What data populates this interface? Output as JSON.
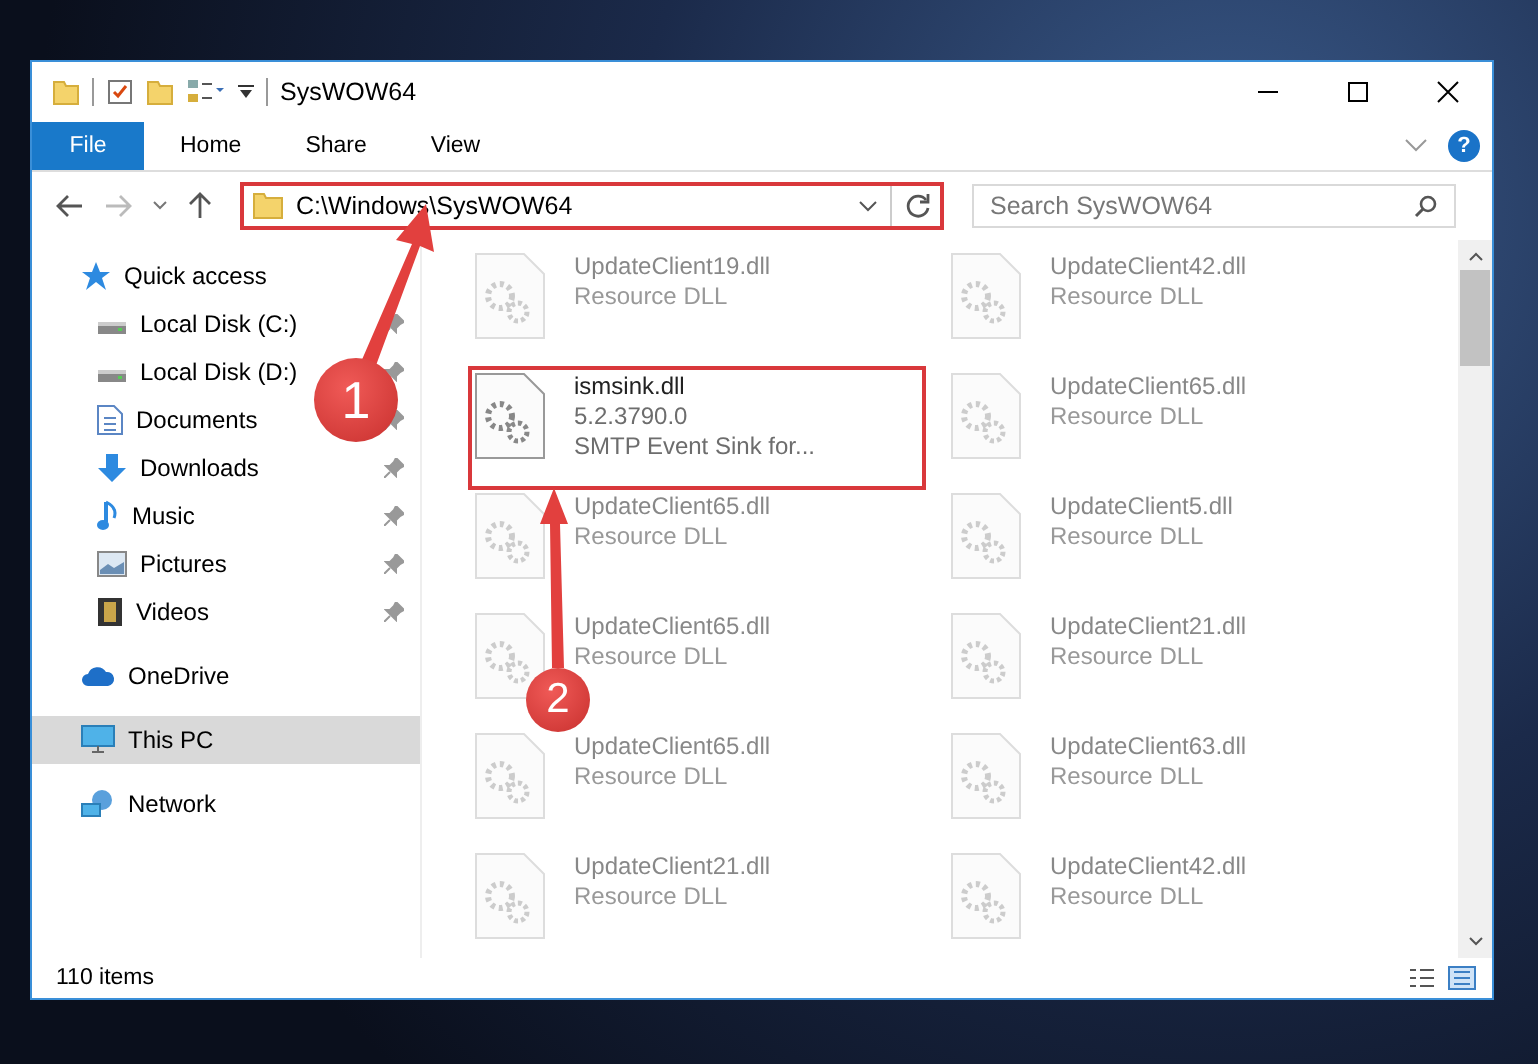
{
  "window": {
    "title": "SysWOW64"
  },
  "ribbon": {
    "tabs": [
      {
        "label": "File",
        "kind": "file"
      },
      {
        "label": "Home",
        "kind": "tab"
      },
      {
        "label": "Share",
        "kind": "tab"
      },
      {
        "label": "View",
        "kind": "tab"
      }
    ],
    "help": "?"
  },
  "address_bar": {
    "path": "C:\\Windows\\SysWOW64"
  },
  "search": {
    "placeholder": "Search SysWOW64"
  },
  "sidebar": {
    "items": [
      {
        "label": "Quick access",
        "kind": "star",
        "selected": false,
        "children": [
          {
            "label": "Local Disk (C:)",
            "kind": "drive",
            "pinned": true
          },
          {
            "label": "Local Disk (D:)",
            "kind": "drive",
            "pinned": true
          },
          {
            "label": "Documents",
            "kind": "document",
            "pinned": true
          },
          {
            "label": "Downloads",
            "kind": "download",
            "pinned": true
          },
          {
            "label": "Music",
            "kind": "music",
            "pinned": true
          },
          {
            "label": "Pictures",
            "kind": "picture",
            "pinned": true
          },
          {
            "label": "Videos",
            "kind": "video",
            "pinned": true
          }
        ]
      },
      {
        "label": "OneDrive",
        "kind": "cloud",
        "selected": false
      },
      {
        "label": "This PC",
        "kind": "pc",
        "selected": true
      },
      {
        "label": "Network",
        "kind": "network",
        "selected": false
      }
    ]
  },
  "files": [
    {
      "name": "UpdateClient19.dll",
      "details": [
        "Resource DLL"
      ],
      "dimmed": true
    },
    {
      "name": "UpdateClient42.dll",
      "details": [
        "Resource DLL"
      ],
      "dimmed": true
    },
    {
      "name": "ismsink.dll",
      "details": [
        "5.2.3790.0",
        "SMTP Event Sink for..."
      ],
      "dimmed": false
    },
    {
      "name": "UpdateClient65.dll",
      "details": [
        "Resource DLL"
      ],
      "dimmed": true
    },
    {
      "name": "UpdateClient65.dll",
      "details": [
        "Resource DLL"
      ],
      "dimmed": true
    },
    {
      "name": "UpdateClient5.dll",
      "details": [
        "Resource DLL"
      ],
      "dimmed": true
    },
    {
      "name": "UpdateClient65.dll",
      "details": [
        "Resource DLL"
      ],
      "dimmed": true
    },
    {
      "name": "UpdateClient21.dll",
      "details": [
        "Resource DLL"
      ],
      "dimmed": true
    },
    {
      "name": "UpdateClient65.dll",
      "details": [
        "Resource DLL"
      ],
      "dimmed": true
    },
    {
      "name": "UpdateClient63.dll",
      "details": [
        "Resource DLL"
      ],
      "dimmed": true
    },
    {
      "name": "UpdateClient21.dll",
      "details": [
        "Resource DLL"
      ],
      "dimmed": true
    },
    {
      "name": "UpdateClient42.dll",
      "details": [
        "Resource DLL"
      ],
      "dimmed": true
    }
  ],
  "status_bar": {
    "count": "110 items"
  },
  "annotations": [
    {
      "label": "1"
    },
    {
      "label": "2"
    }
  ]
}
